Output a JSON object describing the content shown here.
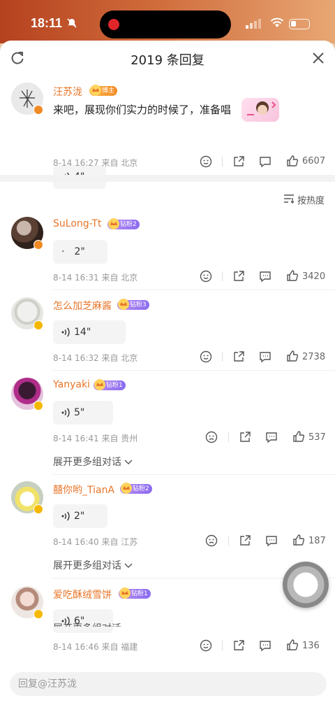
{
  "status": {
    "time": "18:11"
  },
  "header": {
    "title": "2019 条回复"
  },
  "sort": {
    "label": "按热度"
  },
  "pinned": {
    "user": "汪苏泷",
    "badge": "博主",
    "text": "来吧，展现你们实力的时候了，准备唱",
    "voice": "4\"",
    "meta": "8-14 16:27 来自 北京",
    "likes": "6607"
  },
  "comments": [
    {
      "user": "SuLong-Tt",
      "badge": "钻粉2",
      "voice": "2\"",
      "meta": "8-14 16:31 来自 北京",
      "likes": "3420"
    },
    {
      "user": "怎么加芝麻酱",
      "badge": "钻粉3",
      "voice": "14\"",
      "meta": "8-14 16:32 来自 北京",
      "likes": "2738"
    },
    {
      "user": "Yanyaki",
      "badge": "钻粉1",
      "voice": "5\"",
      "meta": "8-14 16:41 来自 贵州",
      "likes": "537",
      "expand": "展开更多组对话"
    },
    {
      "user": "囍你哟_TianA",
      "badge": "钻粉2",
      "voice": "2\"",
      "meta": "8-14 16:40 来自 江苏",
      "likes": "187",
      "expand": "展开更多组对话"
    },
    {
      "user": "爱吃酥绒雪饼",
      "badge": "钻粉1",
      "voice": "6\"",
      "meta": "8-14 16:46 来自 福建",
      "likes": "136",
      "expand": "展开更多组对话"
    }
  ],
  "reply": {
    "placeholder": "回复@汪苏泷"
  },
  "colors": {
    "username": "#e8762a",
    "accent_orange": "#f08a24",
    "badge_purple": "#8b6cf0"
  },
  "icons": [
    "refresh-icon",
    "close-icon",
    "sort-icon",
    "emoji-icon",
    "share-icon",
    "comment-icon",
    "like-icon",
    "voice-wave-icon",
    "chevron-down-icon"
  ]
}
